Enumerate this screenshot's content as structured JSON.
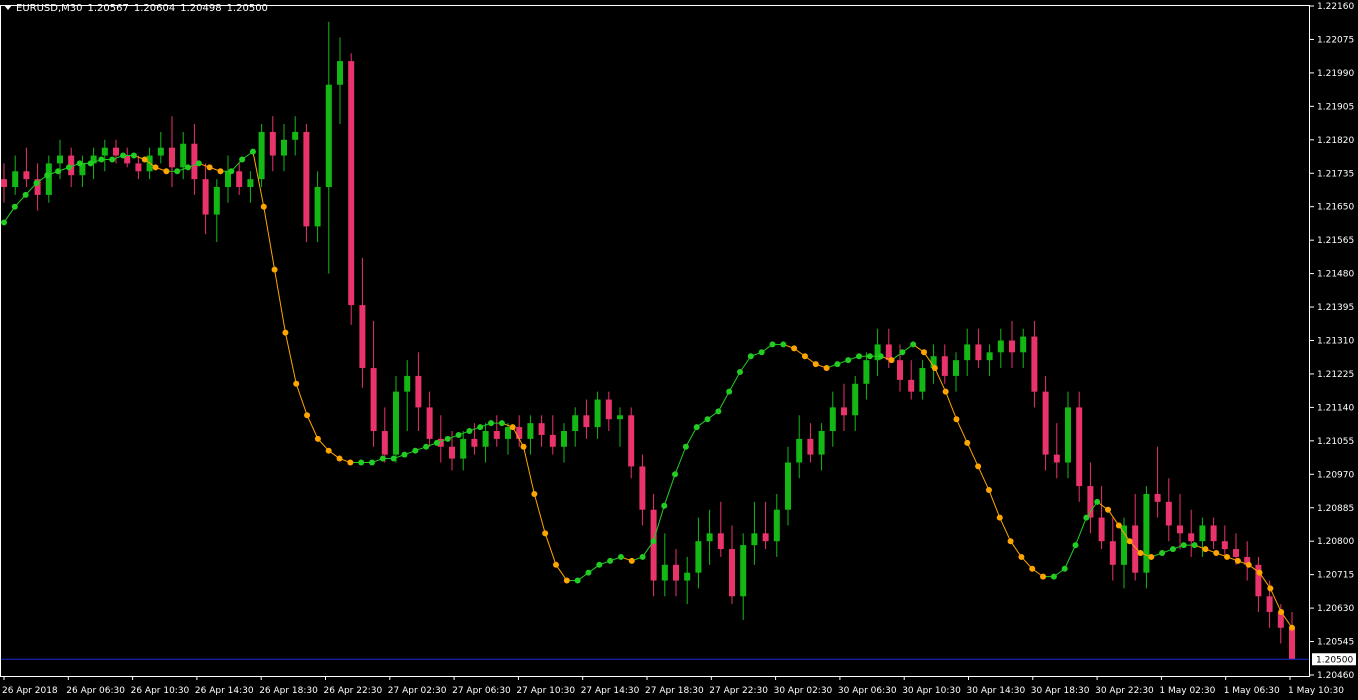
{
  "header": {
    "symbol": "EURUSD,M30",
    "open": "1.20567",
    "high": "1.20604",
    "low": "1.20498",
    "close": "1.20500"
  },
  "colors": {
    "background": "#000000",
    "frame": "#ffffff",
    "bull_candle": "#14b814",
    "bear_candle": "#e8336b",
    "ma_up": "#22cc22",
    "ma_down": "#ffa500",
    "current_price_line": "#1b2bcf"
  },
  "chart_data": {
    "type": "candlestick",
    "symbol": "EURUSD",
    "timeframe": "M30",
    "ylim": [
      1.2046,
      1.2216
    ],
    "y_ticks": [
      "1.22160",
      "1.22075",
      "1.21990",
      "1.21905",
      "1.21820",
      "1.21735",
      "1.21650",
      "1.21565",
      "1.21480",
      "1.21395",
      "1.21310",
      "1.21225",
      "1.21140",
      "1.21055",
      "1.20970",
      "1.20885",
      "1.20800",
      "1.20715",
      "1.20630",
      "1.20545",
      "1.20460"
    ],
    "current_price": "1.20500",
    "x_ticks": [
      "26 Apr 2018",
      "26 Apr 06:30",
      "26 Apr 10:30",
      "26 Apr 14:30",
      "26 Apr 18:30",
      "26 Apr 22:30",
      "27 Apr 02:30",
      "27 Apr 06:30",
      "27 Apr 10:30",
      "27 Apr 14:30",
      "27 Apr 18:30",
      "27 Apr 22:30",
      "30 Apr 02:30",
      "30 Apr 06:30",
      "30 Apr 10:30",
      "30 Apr 14:30",
      "30 Apr 18:30",
      "30 Apr 22:30",
      "1 May 02:30",
      "1 May 06:30",
      "1 May 10:30"
    ],
    "candles_note": "OHLC estimated per 30-minute bar, left to right",
    "candles": [
      [
        1.2172,
        1.2176,
        1.2166,
        1.217
      ],
      [
        1.217,
        1.2178,
        1.2168,
        1.2174
      ],
      [
        1.2174,
        1.218,
        1.217,
        1.2172
      ],
      [
        1.2172,
        1.2176,
        1.2164,
        1.2168
      ],
      [
        1.2168,
        1.2178,
        1.2166,
        1.2176
      ],
      [
        1.2176,
        1.2182,
        1.2172,
        1.2178
      ],
      [
        1.2178,
        1.218,
        1.217,
        1.2173
      ],
      [
        1.2173,
        1.2178,
        1.217,
        1.2176
      ],
      [
        1.2176,
        1.218,
        1.2172,
        1.2178
      ],
      [
        1.2178,
        1.2182,
        1.2174,
        1.218
      ],
      [
        1.218,
        1.2182,
        1.2176,
        1.2178
      ],
      [
        1.2178,
        1.218,
        1.2175,
        1.2176
      ],
      [
        1.2176,
        1.2178,
        1.2172,
        1.2174
      ],
      [
        1.2174,
        1.218,
        1.2172,
        1.2178
      ],
      [
        1.2178,
        1.2184,
        1.2176,
        1.218
      ],
      [
        1.218,
        1.2188,
        1.217,
        1.2175
      ],
      [
        1.2175,
        1.2184,
        1.2172,
        1.2181
      ],
      [
        1.2181,
        1.2186,
        1.2168,
        1.2172
      ],
      [
        1.2172,
        1.2176,
        1.2158,
        1.2163
      ],
      [
        1.2163,
        1.2172,
        1.2156,
        1.217
      ],
      [
        1.217,
        1.2178,
        1.2166,
        1.2174
      ],
      [
        1.2174,
        1.2176,
        1.2168,
        1.217
      ],
      [
        1.217,
        1.2174,
        1.2166,
        1.2172
      ],
      [
        1.2172,
        1.2186,
        1.217,
        1.2184
      ],
      [
        1.2184,
        1.2188,
        1.2174,
        1.2178
      ],
      [
        1.2178,
        1.2186,
        1.2174,
        1.2182
      ],
      [
        1.2182,
        1.2188,
        1.2178,
        1.2184
      ],
      [
        1.2184,
        1.2186,
        1.2156,
        1.216
      ],
      [
        1.216,
        1.2174,
        1.2156,
        1.217
      ],
      [
        1.217,
        1.2212,
        1.2148,
        1.2196
      ],
      [
        1.2196,
        1.2208,
        1.2186,
        1.2202
      ],
      [
        1.2202,
        1.2204,
        1.2135,
        1.214
      ],
      [
        1.214,
        1.2152,
        1.2119,
        1.2124
      ],
      [
        1.2124,
        1.2136,
        1.2104,
        1.2108
      ],
      [
        1.2108,
        1.2114,
        1.21,
        1.2102
      ],
      [
        1.2102,
        1.2122,
        1.21,
        1.2118
      ],
      [
        1.2118,
        1.2126,
        1.2108,
        1.2122
      ],
      [
        1.2122,
        1.2128,
        1.2108,
        1.2114
      ],
      [
        1.2114,
        1.2118,
        1.2104,
        1.2106
      ],
      [
        1.2106,
        1.2112,
        1.21,
        1.2104
      ],
      [
        1.2104,
        1.2108,
        1.2098,
        1.2101
      ],
      [
        1.2101,
        1.2108,
        1.2098,
        1.2106
      ],
      [
        1.2106,
        1.211,
        1.2102,
        1.2104
      ],
      [
        1.2104,
        1.211,
        1.21,
        1.2108
      ],
      [
        1.2108,
        1.2112,
        1.2104,
        1.2106
      ],
      [
        1.2106,
        1.211,
        1.2102,
        1.2109
      ],
      [
        1.2109,
        1.2112,
        1.2104,
        1.2106
      ],
      [
        1.2106,
        1.2112,
        1.2102,
        1.211
      ],
      [
        1.211,
        1.2112,
        1.2104,
        1.2107
      ],
      [
        1.2107,
        1.2112,
        1.2102,
        1.2104
      ],
      [
        1.2104,
        1.211,
        1.21,
        1.2108
      ],
      [
        1.2108,
        1.2114,
        1.2104,
        1.2112
      ],
      [
        1.2112,
        1.2116,
        1.2106,
        1.2109
      ],
      [
        1.2109,
        1.2118,
        1.2106,
        1.2116
      ],
      [
        1.2116,
        1.2118,
        1.2108,
        1.2111
      ],
      [
        1.2111,
        1.2114,
        1.2104,
        1.2112
      ],
      [
        1.2112,
        1.2114,
        1.2096,
        1.2099
      ],
      [
        1.2099,
        1.2102,
        1.2084,
        1.2088
      ],
      [
        1.2088,
        1.2092,
        1.2066,
        1.207
      ],
      [
        1.207,
        1.2082,
        1.2066,
        1.2074
      ],
      [
        1.2074,
        1.2078,
        1.2066,
        1.207
      ],
      [
        1.207,
        1.2076,
        1.2064,
        1.2072
      ],
      [
        1.2072,
        1.2086,
        1.2068,
        1.208
      ],
      [
        1.208,
        1.2088,
        1.2074,
        1.2082
      ],
      [
        1.2082,
        1.209,
        1.2076,
        1.2078
      ],
      [
        1.2078,
        1.2084,
        1.2064,
        1.2066
      ],
      [
        1.2066,
        1.2082,
        1.206,
        1.2079
      ],
      [
        1.2079,
        1.209,
        1.2074,
        1.2082
      ],
      [
        1.2082,
        1.209,
        1.2078,
        1.208
      ],
      [
        1.208,
        1.2092,
        1.2076,
        1.2088
      ],
      [
        1.2088,
        1.2104,
        1.2084,
        1.21
      ],
      [
        1.21,
        1.2112,
        1.2096,
        1.2106
      ],
      [
        1.2106,
        1.211,
        1.21,
        1.2102
      ],
      [
        1.2102,
        1.211,
        1.2098,
        1.2108
      ],
      [
        1.2108,
        1.2118,
        1.2104,
        1.2114
      ],
      [
        1.2114,
        1.212,
        1.2108,
        1.2112
      ],
      [
        1.2112,
        1.2122,
        1.2108,
        1.212
      ],
      [
        1.212,
        1.2128,
        1.2116,
        1.2126
      ],
      [
        1.2126,
        1.2134,
        1.2122,
        1.213
      ],
      [
        1.213,
        1.2134,
        1.2124,
        1.2126
      ],
      [
        1.2126,
        1.213,
        1.2118,
        1.2121
      ],
      [
        1.2121,
        1.2126,
        1.2116,
        1.2118
      ],
      [
        1.2118,
        1.2126,
        1.2116,
        1.2124
      ],
      [
        1.2124,
        1.213,
        1.212,
        1.2127
      ],
      [
        1.2127,
        1.213,
        1.212,
        1.2122
      ],
      [
        1.2122,
        1.2128,
        1.2118,
        1.2126
      ],
      [
        1.2126,
        1.2134,
        1.2122,
        1.213
      ],
      [
        1.213,
        1.2134,
        1.2124,
        1.2126
      ],
      [
        1.2126,
        1.213,
        1.2122,
        1.2128
      ],
      [
        1.2128,
        1.2134,
        1.2124,
        1.2131
      ],
      [
        1.2131,
        1.2136,
        1.2124,
        1.2128
      ],
      [
        1.2128,
        1.2134,
        1.2124,
        1.2132
      ],
      [
        1.2132,
        1.2136,
        1.2114,
        1.2118
      ],
      [
        1.2118,
        1.2122,
        1.2098,
        1.2102
      ],
      [
        1.2102,
        1.211,
        1.2096,
        1.21
      ],
      [
        1.21,
        1.2118,
        1.2096,
        1.2114
      ],
      [
        1.2114,
        1.2118,
        1.209,
        1.2094
      ],
      [
        1.2094,
        1.21,
        1.2082,
        1.2086
      ],
      [
        1.2086,
        1.2094,
        1.2078,
        1.208
      ],
      [
        1.208,
        1.2086,
        1.207,
        1.2074
      ],
      [
        1.2074,
        1.2086,
        1.2068,
        1.2084
      ],
      [
        1.2084,
        1.2092,
        1.207,
        1.2072
      ],
      [
        1.2072,
        1.2094,
        1.2068,
        1.2092
      ],
      [
        1.2092,
        1.2104,
        1.2086,
        1.209
      ],
      [
        1.209,
        1.2096,
        1.208,
        1.2084
      ],
      [
        1.2084,
        1.2092,
        1.2078,
        1.2082
      ],
      [
        1.2082,
        1.2088,
        1.2076,
        1.208
      ],
      [
        1.208,
        1.2086,
        1.2076,
        1.2084
      ],
      [
        1.2084,
        1.2086,
        1.2078,
        1.208
      ],
      [
        1.208,
        1.2084,
        1.2076,
        1.2078
      ],
      [
        1.2078,
        1.2082,
        1.2074,
        1.2076
      ],
      [
        1.2076,
        1.208,
        1.207,
        1.2074
      ],
      [
        1.2074,
        1.2076,
        1.2062,
        1.2066
      ],
      [
        1.2066,
        1.207,
        1.2058,
        1.2062
      ],
      [
        1.2062,
        1.2064,
        1.2054,
        1.2058
      ],
      [
        1.2058,
        1.2062,
        1.205,
        1.205
      ]
    ],
    "ma_values": [
      1.2161,
      1.2165,
      1.2168,
      1.2171,
      1.2173,
      1.2174,
      1.2175,
      1.2176,
      1.2176,
      1.2177,
      1.2177,
      1.2178,
      1.2178,
      1.2177,
      1.2175,
      1.2174,
      1.2174,
      1.2175,
      1.2176,
      1.2175,
      1.2174,
      1.2174,
      1.2177,
      1.2179,
      1.2165,
      1.2149,
      1.2133,
      1.212,
      1.2112,
      1.2106,
      1.2103,
      1.2101,
      1.21,
      1.21,
      1.21,
      1.2101,
      1.2101,
      1.2102,
      1.2103,
      1.2104,
      1.2105,
      1.2106,
      1.2107,
      1.2108,
      1.2109,
      1.211,
      1.211,
      1.2109,
      1.2104,
      1.2092,
      1.2082,
      1.2074,
      1.207,
      1.207,
      1.2072,
      1.2074,
      1.2075,
      1.2076,
      1.2075,
      1.2076,
      1.208,
      1.2089,
      1.2097,
      1.2104,
      1.2109,
      1.2111,
      1.2113,
      1.2118,
      1.2123,
      1.2127,
      1.2128,
      1.213,
      1.213,
      1.2129,
      1.2127,
      1.2125,
      1.2124,
      1.2125,
      1.2126,
      1.2127,
      1.2127,
      1.2127,
      1.2126,
      1.2128,
      1.213,
      1.2128,
      1.2124,
      1.2118,
      1.2111,
      1.2105,
      1.2099,
      1.2093,
      1.2086,
      1.208,
      1.2076,
      1.2073,
      1.2071,
      1.2071,
      1.2073,
      1.2079,
      1.2086,
      1.209,
      1.2088,
      1.2084,
      1.208,
      1.2077,
      1.2076,
      1.2077,
      1.2078,
      1.2079,
      1.2079,
      1.2078,
      1.2077,
      1.2076,
      1.2075,
      1.2074,
      1.2072,
      1.2068,
      1.2062,
      1.2058
    ]
  }
}
